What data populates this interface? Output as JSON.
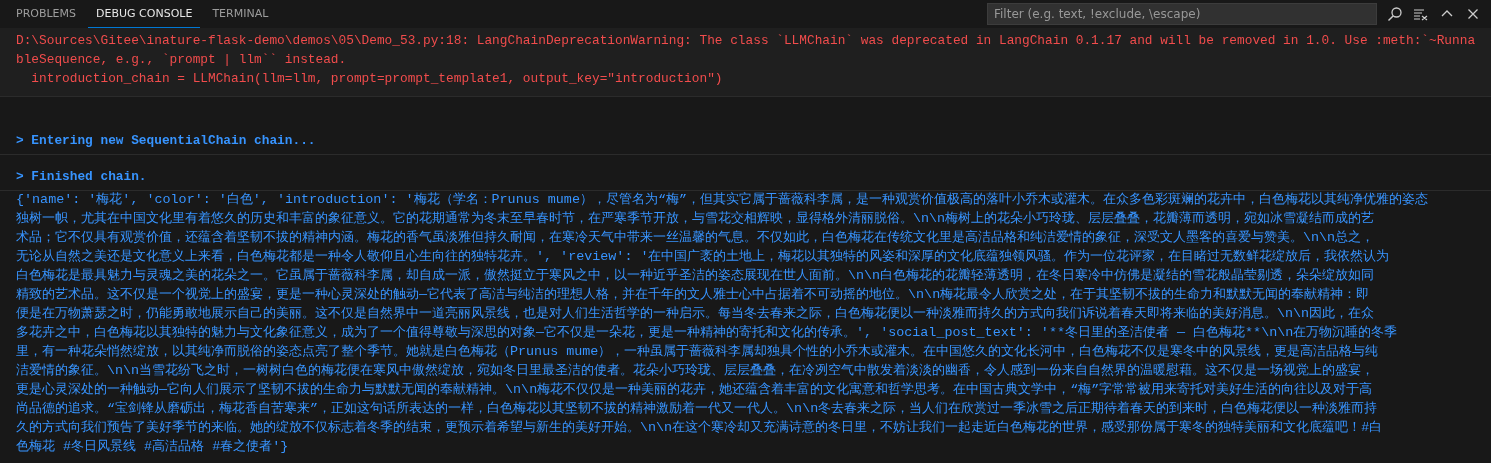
{
  "panel": {
    "tabs": [
      {
        "label": "PROBLEMS",
        "selected": false
      },
      {
        "label": "DEBUG CONSOLE",
        "selected": true
      },
      {
        "label": "TERMINAL",
        "selected": false
      }
    ],
    "filter": {
      "placeholder": "Filter (e.g. text, !exclude, \\escape)"
    }
  },
  "console": [
    {
      "kind": "warning",
      "lines": [
        "D:\\Sources\\Gitee\\inature-flask-demo\\demos\\05\\Demo_53.py:18: LangChainDeprecationWarning: The class `LLMChain` was deprecated in LangChain 0.1.17 and will be removed in 1.0. Use :meth:`~Runna",
        "bleSequence, e.g., `prompt | llm`` instead.",
        "  introduction_chain = LLMChain(llm=llm, prompt=prompt_template1, output_key=\"introduction\")"
      ]
    },
    {
      "kind": "chain",
      "lines": [
        "> Entering new SequentialChain chain..."
      ]
    },
    {
      "kind": "chain",
      "lines": [
        "> Finished chain."
      ]
    },
    {
      "kind": "output",
      "lines": [
        "{'name': '梅花', 'color': '白色', 'introduction': '梅花（学名：Prunus mume），尽管名为“梅”，但其实它属于蔷薇科李属，是一种观赏价值极高的落叶小乔木或灌木。在众多色彩斑斓的花卉中，白色梅花以其纯净优雅的姿态",
        "独树一帜，尤其在中国文化里有着悠久的历史和丰富的象征意义。它的花期通常为冬末至早春时节，在严寒季节开放，与雪花交相辉映，显得格外清丽脱俗。\\n\\n梅树上的花朵小巧玲珑、层层叠叠，花瓣薄而透明，宛如冰雪凝结而成的艺",
        "术品；它不仅具有观赏价值，还蕴含着坚韧不拔的精神内涵。梅花的香气虽淡雅但持久耐闻，在寒冷天气中带来一丝温馨的气息。不仅如此，白色梅花在传统文化里是高洁品格和纯洁爱情的象征，深受文人墨客的喜爱与赞美。\\n\\n总之，",
        "无论从自然之美还是文化意义上来看，白色梅花都是一种令人敬仰且心生向往的独特花卉。', 'review': '在中国广袤的土地上，梅花以其独特的风姿和深厚的文化底蕴独领风骚。作为一位花评家，在目睹过无数鲜花绽放后，我依然认为",
        "白色梅花是最具魅力与灵魂之美的花朵之一。它虽属于蔷薇科李属，却自成一派，傲然挺立于寒风之中，以一种近乎圣洁的姿态展现在世人面前。\\n\\n白色梅花的花瓣轻薄透明，在冬日寒冷中仿佛是凝结的雪花般晶莹剔透，朵朵绽放如同",
        "精致的艺术品。这不仅是一个视觉上的盛宴，更是一种心灵深处的触动—它代表了高洁与纯洁的理想人格，并在千年的文人雅士心中占据着不可动摇的地位。\\n\\n梅花最令人欣赏之处，在于其坚韧不拔的生命力和默默无闻的奉献精神：即",
        "便是在万物萧瑟之时，仍能勇敢地展示自己的美丽。这不仅是自然界中一道亮丽风景线，也是对人们生活哲学的一种启示。每当冬去春来之际，白色梅花便以一种淡雅而持久的方式向我们诉说着春天即将来临的美好消息。\\n\\n因此，在众",
        "多花卉之中，白色梅花以其独特的魅力与文化象征意义，成为了一个值得尊敬与深思的对象—它不仅是一朵花，更是一种精神的寄托和文化的传承。', 'social_post_text': '**冬日里的圣洁使者 — 白色梅花**\\n\\n在万物沉睡的冬季",
        "里，有一种花朵悄然绽放，以其纯净而脱俗的姿态点亮了整个季节。她就是白色梅花（Prunus mume），一种虽属于蔷薇科李属却独具个性的小乔木或灌木。在中国悠久的文化长河中，白色梅花不仅是寒冬中的风景线，更是高洁品格与纯",
        "洁爱情的象征。\\n\\n当雪花纷飞之时，一树树白色的梅花便在寒风中傲然绽放，宛如冬日里最圣洁的使者。花朵小巧玲珑、层层叠叠，在冷冽空气中散发着淡淡的幽香，令人感到一份来自自然界的温暖慰藉。这不仅是一场视觉上的盛宴，",
        "更是心灵深处的一种触动—它向人们展示了坚韧不拔的生命力与默默无闻的奉献精神。\\n\\n梅花不仅仅是一种美丽的花卉，她还蕴含着丰富的文化寓意和哲学思考。在中国古典文学中，“梅”字常常被用来寄托对美好生活的向往以及对于高",
        "尚品德的追求。“宝剑锋从磨砺出，梅花香自苦寒来”，正如这句话所表达的一样，白色梅花以其坚韧不拔的精神激励着一代又一代人。\\n\\n冬去春来之际，当人们在欣赏过一季冰雪之后正期待着春天的到来时，白色梅花便以一种淡雅而持",
        "久的方式向我们预告了美好季节的来临。她的绽放不仅标志着冬季的结束，更预示着希望与新生的美好开始。\\n\\n在这个寒冷却又充满诗意的冬日里，不妨让我们一起走近白色梅花的世界，感受那份属于寒冬的独特美丽和文化底蕴吧！#白",
        "色梅花 #冬日风景线 #高洁品格 #春之使者'}"
      ]
    }
  ]
}
